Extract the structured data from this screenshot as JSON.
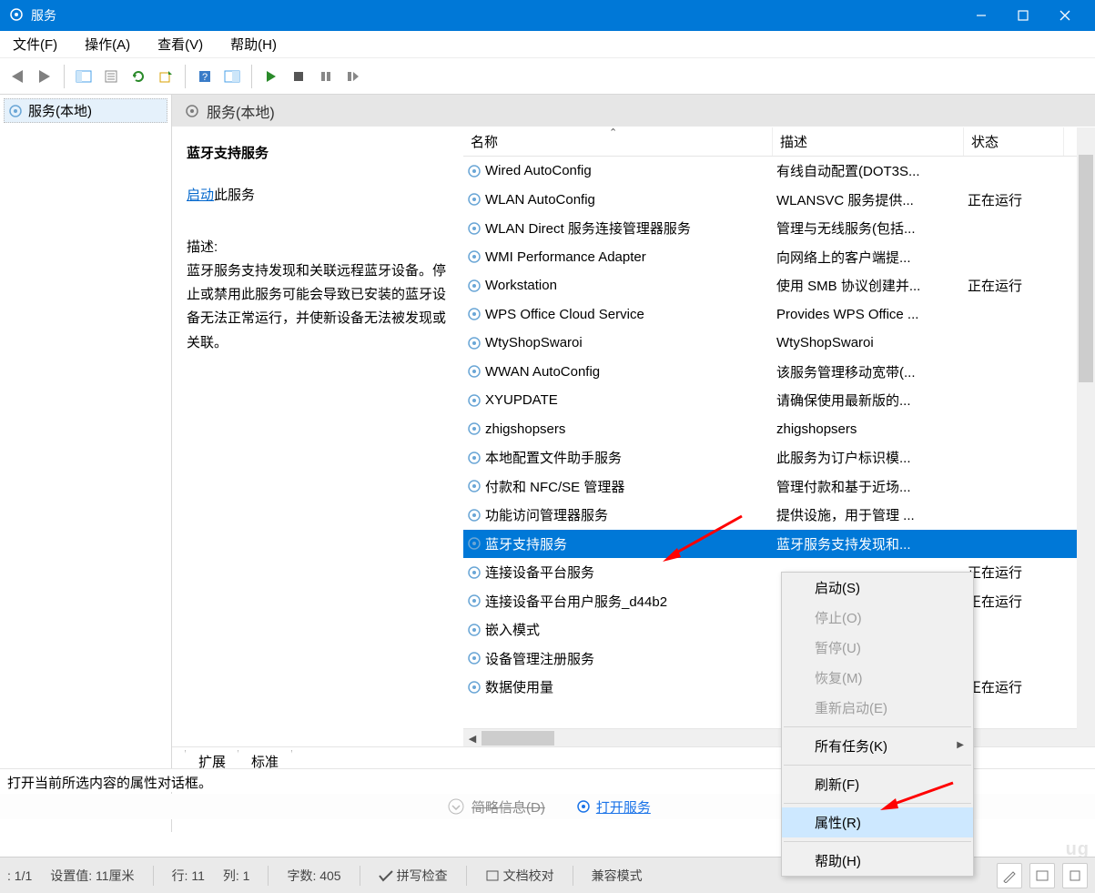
{
  "window": {
    "title": "服务"
  },
  "menubar": {
    "file": "文件(F)",
    "action": "操作(A)",
    "view": "查看(V)",
    "help": "帮助(H)"
  },
  "tree": {
    "root": "服务(本地)"
  },
  "pane_title": "服务(本地)",
  "detail": {
    "name": "蓝牙支持服务",
    "start_link": "启动",
    "start_suffix": "此服务",
    "desc_label": "描述:",
    "desc_text": "蓝牙服务支持发现和关联远程蓝牙设备。停止或禁用此服务可能会导致已安装的蓝牙设备无法正常运行，并使新设备无法被发现或关联。"
  },
  "list": {
    "headers": {
      "name": "名称",
      "desc": "描述",
      "status": "状态"
    },
    "rows": [
      {
        "name": "Wired AutoConfig",
        "desc": "有线自动配置(DOT3S...",
        "status": "",
        "selected": false
      },
      {
        "name": "WLAN AutoConfig",
        "desc": "WLANSVC 服务提供...",
        "status": "正在运行",
        "selected": false
      },
      {
        "name": "WLAN Direct 服务连接管理器服务",
        "desc": "管理与无线服务(包括...",
        "status": "",
        "selected": false
      },
      {
        "name": "WMI Performance Adapter",
        "desc": "向网络上的客户端提...",
        "status": "",
        "selected": false
      },
      {
        "name": "Workstation",
        "desc": "使用 SMB 协议创建并...",
        "status": "正在运行",
        "selected": false
      },
      {
        "name": "WPS Office Cloud Service",
        "desc": "Provides WPS Office ...",
        "status": "",
        "selected": false
      },
      {
        "name": "WtyShopSwaroi",
        "desc": "WtyShopSwaroi",
        "status": "",
        "selected": false
      },
      {
        "name": "WWAN AutoConfig",
        "desc": "该服务管理移动宽带(...",
        "status": "",
        "selected": false
      },
      {
        "name": "XYUPDATE",
        "desc": "请确保使用最新版的...",
        "status": "",
        "selected": false
      },
      {
        "name": "zhigshopsers",
        "desc": "zhigshopsers",
        "status": "",
        "selected": false
      },
      {
        "name": "本地配置文件助手服务",
        "desc": "此服务为订户标识模...",
        "status": "",
        "selected": false
      },
      {
        "name": "付款和 NFC/SE 管理器",
        "desc": "管理付款和基于近场...",
        "status": "",
        "selected": false
      },
      {
        "name": "功能访问管理器服务",
        "desc": "提供设施，用于管理 ...",
        "status": "",
        "selected": false
      },
      {
        "name": "蓝牙支持服务",
        "desc": "蓝牙服务支持发现和...",
        "status": "",
        "selected": true
      },
      {
        "name": "连接设备平台服务",
        "desc": "",
        "status": "正在运行",
        "selected": false
      },
      {
        "name": "连接设备平台用户服务_d44b2",
        "desc": "",
        "status": "正在运行",
        "selected": false
      },
      {
        "name": "嵌入模式",
        "desc": "",
        "status": "",
        "selected": false
      },
      {
        "name": "设备管理注册服务",
        "desc": "",
        "status": "",
        "selected": false
      },
      {
        "name": "数据使用量",
        "desc": "",
        "status": "正在运行",
        "selected": false
      }
    ]
  },
  "tabs": {
    "extended": "扩展",
    "standard": "标准"
  },
  "status_text": "打开当前所选内容的属性对话框。",
  "secondary": {
    "info": "简略信息(D)",
    "open": "打开服务"
  },
  "contextmenu": {
    "start": "启动(S)",
    "stop": "停止(O)",
    "pause": "暂停(U)",
    "resume": "恢复(M)",
    "restart": "重新启动(E)",
    "alltasks": "所有任务(K)",
    "refresh": "刷新(F)",
    "properties": "属性(R)",
    "help": "帮助(H)"
  },
  "bottombar": {
    "page": ": 1/1",
    "setval": "设置值: 11厘米",
    "line": "行: 11",
    "col": "列: 1",
    "chars": "字数: 405",
    "spell": "拼写检查",
    "proof": "文档校对",
    "compat": "兼容模式"
  }
}
